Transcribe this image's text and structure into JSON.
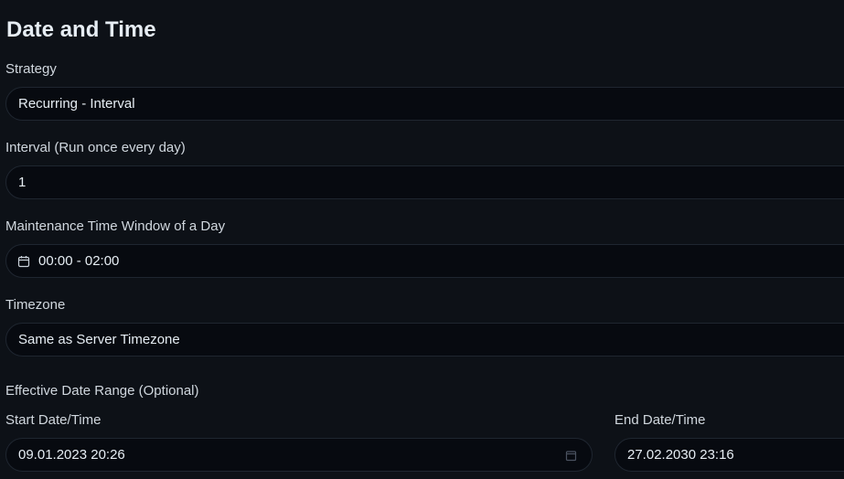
{
  "heading": "Date and Time",
  "strategy": {
    "label": "Strategy",
    "value": "Recurring - Interval"
  },
  "interval": {
    "label": "Interval (Run once every day)",
    "value": "1"
  },
  "maintenance": {
    "label": "Maintenance Time Window of a Day",
    "value": "00:00 - 02:00",
    "icon": "calendar-icon"
  },
  "timezone": {
    "label": "Timezone",
    "value": "Same as Server Timezone"
  },
  "date_range": {
    "label": "Effective Date Range (Optional)",
    "start": {
      "label": "Start Date/Time",
      "value": "09.01.2023 20:26",
      "icon": "calendar-picker-icon"
    },
    "end": {
      "label": "End Date/Time",
      "value": "27.02.2030 23:16"
    }
  },
  "colors": {
    "background": "#0d1117",
    "field_bg": "#070a10",
    "field_border": "#1f2630",
    "text": "#e6edf3"
  }
}
